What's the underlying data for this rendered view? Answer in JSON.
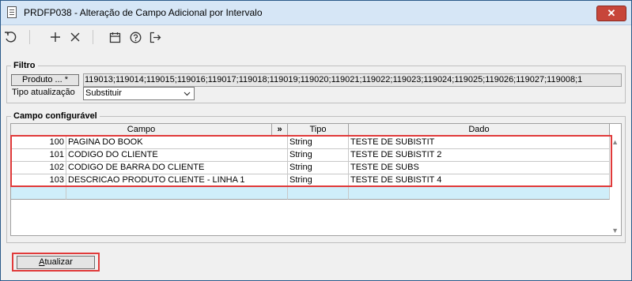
{
  "window": {
    "title": "PRDFP038 - Alteração de Campo Adicional por Intervalo",
    "close_label": "✕"
  },
  "toolbar": {
    "icons": [
      "refresh-icon",
      "add-icon",
      "delete-icon",
      "calendar-icon",
      "help-icon",
      "exit-icon"
    ]
  },
  "filtro": {
    "legend": "Filtro",
    "produto_button": "Produto ... *",
    "produto_values": "119013;119014;119015;119016;119017;119018;119019;119020;119021;119022;119023;119024;119025;119026;119027;119008;1",
    "tipo_label": "Tipo atualização",
    "tipo_value": "Substituir"
  },
  "campos": {
    "legend": "Campo configurável",
    "headers": {
      "campo": "Campo",
      "expand": "»",
      "tipo": "Tipo",
      "dado": "Dado"
    },
    "rows": [
      {
        "id": "100",
        "name": "PAGINA DO BOOK",
        "tipo": "String",
        "dado": "TESTE DE SUBISTIT"
      },
      {
        "id": "101",
        "name": "CODIGO DO CLIENTE",
        "tipo": "String",
        "dado": "TESTE DE SUBISTIT 2"
      },
      {
        "id": "102",
        "name": "CODIGO DE BARRA DO CLIENTE",
        "tipo": "String",
        "dado": "TESTE DE SUBS"
      },
      {
        "id": "103",
        "name": "DESCRICAO PRODUTO CLIENTE - LINHA 1",
        "tipo": "String",
        "dado": "TESTE DE SUBISTIT 4"
      }
    ]
  },
  "footer": {
    "atualizar_label": "Atualizar"
  },
  "colors": {
    "highlight": "#e03a3a",
    "new_row": "#cfeefa",
    "titlebar": "#d6e6f6"
  }
}
